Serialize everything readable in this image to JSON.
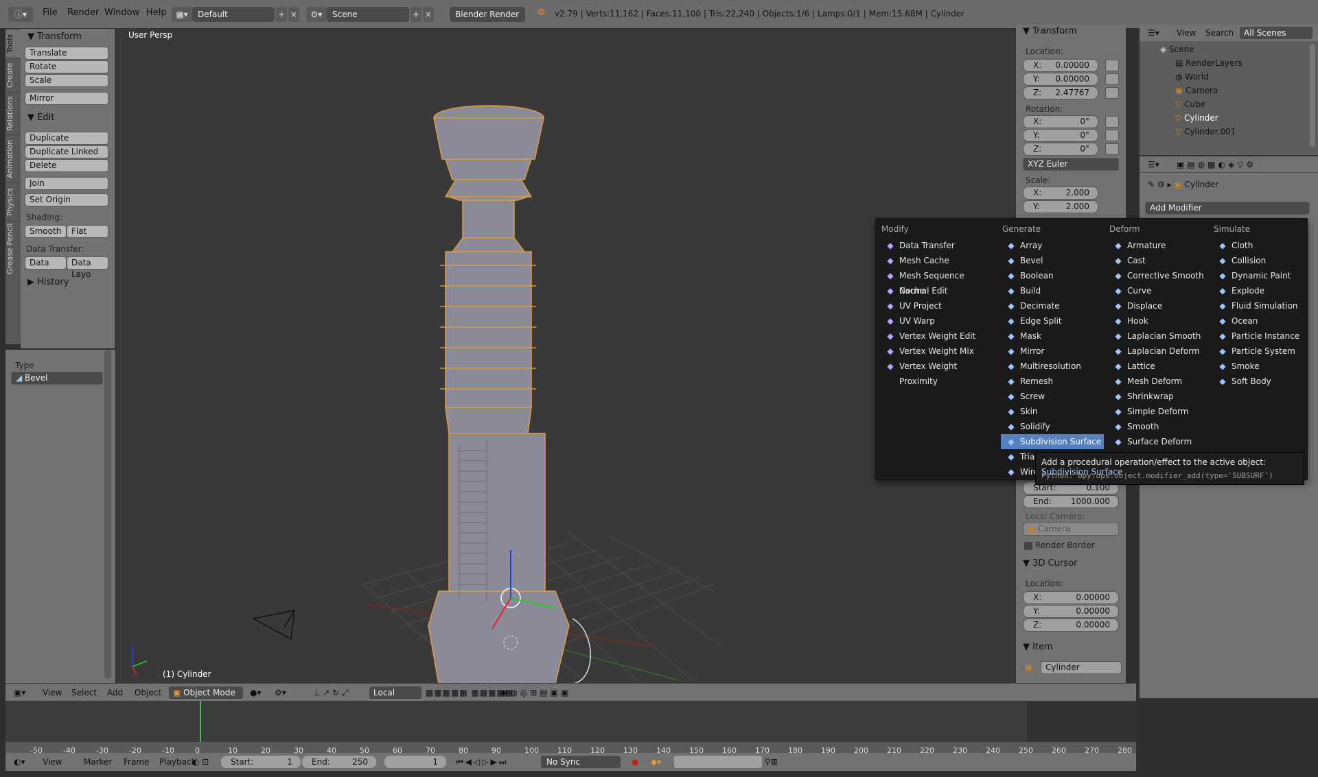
{
  "topbar": {
    "menus": [
      "File",
      "Render",
      "Window",
      "Help"
    ],
    "layout": "Default",
    "scene": "Scene",
    "engine": "Blender Render",
    "stats": "v2.79 | Verts:11,162 | Faces:11,100 | Tris:22,240 | Objects:1/6 | Lamps:0/1 | Mem:15.68M | Cylinder"
  },
  "lefttabs": [
    "Tools",
    "Create",
    "Relations",
    "Animation",
    "Physics",
    "Grease Pencil"
  ],
  "toolshelf": {
    "transform_header": "Transform",
    "translate": "Translate",
    "rotate": "Rotate",
    "scale": "Scale",
    "mirror": "Mirror",
    "edit_header": "Edit",
    "duplicate": "Duplicate",
    "duplicate_linked": "Duplicate Linked",
    "delete": "Delete",
    "join": "Join",
    "set_origin": "Set Origin",
    "shading_label": "Shading:",
    "smooth": "Smooth",
    "flat": "Flat",
    "data_transfer_label": "Data Transfer:",
    "data": "Data",
    "data_layo": "Data Layo",
    "history_header": "History"
  },
  "operator": {
    "type_label": "Type",
    "type_value": "Bevel"
  },
  "viewport": {
    "view_name": "User Persp",
    "object_label": "(1) Cylinder"
  },
  "npanel": {
    "transform_header": "Transform",
    "location_label": "Location:",
    "loc_x": "0.00000",
    "loc_y": "0.00000",
    "loc_z": "2.47767",
    "rotation_label": "Rotation:",
    "rot_x": "0°",
    "rot_y": "0°",
    "rot_z": "0°",
    "rotation_mode": "XYZ Euler",
    "scale_label": "Scale:",
    "scale_x": "2.000",
    "scale_y": "2.000",
    "start_label": "Start:",
    "start_value": "0.100",
    "end_label": "End:",
    "end_value": "1000.000",
    "local_camera_label": "Local Camera:",
    "camera_placeholder": "Camera",
    "render_border": "Render Border",
    "cursor_header": "3D Cursor",
    "cursor_location_label": "Location:",
    "cur_x": "0.00000",
    "cur_y": "0.00000",
    "cur_z": "0.00000",
    "item_header": "Item",
    "item_name": "Cylinder",
    "x": "X:",
    "y": "Y:",
    "z": "Z:"
  },
  "outliner": {
    "tabs": [
      "View",
      "Search",
      "All Scenes"
    ],
    "rows": [
      "Scene",
      "RenderLayers",
      "World",
      "Camera",
      "Cube",
      "Cylinder",
      "Cylinder.001"
    ]
  },
  "props": {
    "object_name": "Cylinder",
    "add_modifier": "Add Modifier"
  },
  "menu": {
    "modify_header": "Modify",
    "modify": [
      "Data Transfer",
      "Mesh Cache",
      "Mesh Sequence Cache",
      "Normal Edit",
      "UV Project",
      "UV Warp",
      "Vertex Weight Edit",
      "Vertex Weight Mix",
      "Vertex Weight Proximity"
    ],
    "generate_header": "Generate",
    "generate": [
      "Array",
      "Bevel",
      "Boolean",
      "Build",
      "Decimate",
      "Edge Split",
      "Mask",
      "Mirror",
      "Multiresolution",
      "Remesh",
      "Screw",
      "Skin",
      "Solidify",
      "Subdivision Surface",
      "Triangulate",
      "Wireframe"
    ],
    "deform_header": "Deform",
    "deform": [
      "Armature",
      "Cast",
      "Corrective Smooth",
      "Curve",
      "Displace",
      "Hook",
      "Laplacian Smooth",
      "Laplacian Deform",
      "Lattice",
      "Mesh Deform",
      "Shrinkwrap",
      "Simple Deform",
      "Smooth",
      "Surface Deform"
    ],
    "simulate_header": "Simulate",
    "simulate": [
      "Cloth",
      "Collision",
      "Dynamic Paint",
      "Explode",
      "Fluid Simulation",
      "Ocean",
      "Particle Instance",
      "Particle System",
      "Smoke",
      "Soft Body"
    ],
    "selected": "Subdivision Surface"
  },
  "tooltip": {
    "text": "Add a procedural operation/effect to the active object:",
    "highlight": "Subdivision Surface",
    "python": "Python: bpy.ops.object.modifier_add(type='SUBSURF')"
  },
  "vpheader": {
    "view": "View",
    "select": "Select",
    "add": "Add",
    "object": "Object",
    "mode": "Object Mode",
    "pivot": "Local"
  },
  "timeline": {
    "ticks": [
      "-50",
      "-40",
      "-30",
      "-20",
      "-10",
      "0",
      "10",
      "20",
      "30",
      "40",
      "50",
      "60",
      "70",
      "80",
      "90",
      "100",
      "110",
      "120",
      "130",
      "140",
      "150",
      "160",
      "170",
      "180",
      "190",
      "200",
      "210",
      "220",
      "230",
      "240",
      "250",
      "260",
      "270",
      "280"
    ]
  },
  "tlheader": {
    "view": "View",
    "marker": "Marker",
    "frame": "Frame",
    "playback": "Playback",
    "start_label": "Start:",
    "start_value": "1",
    "end_label": "End:",
    "end_value": "250",
    "current": "1",
    "sync": "No Sync"
  }
}
